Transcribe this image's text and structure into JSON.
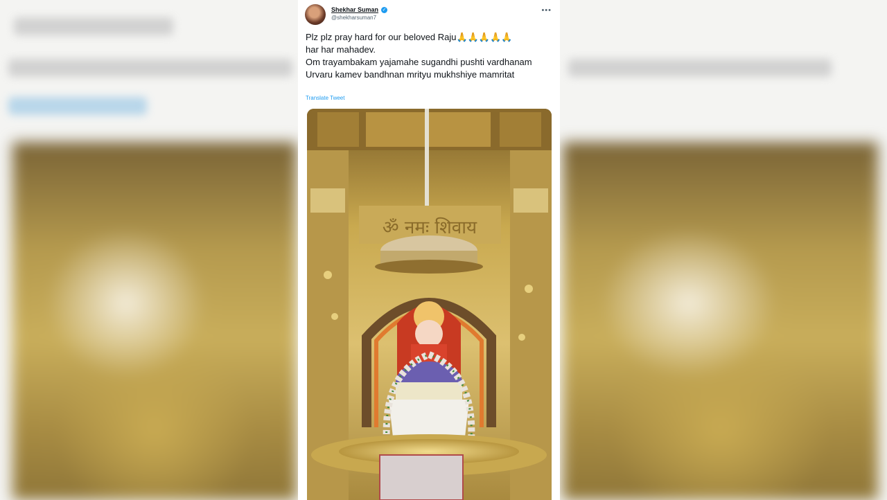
{
  "tweet": {
    "author_name": "Shekhar Suman",
    "author_handle": "@shekharsuman7",
    "more_icon": "more-horizontal-icon",
    "verified_icon": "verified-badge-icon",
    "lines": [
      "Plz plz pray hard for our beloved Raju🙏🙏🙏🙏🙏",
      "har har mahadev.",
      "Om trayambakam yajamahe sugandhi pushti vardhanam",
      "Urvaru kamev bandhnan mrityu mukhshiye mamritat"
    ],
    "translate_label": "Translate Tweet",
    "media_inscription": "ॐ नमः शिवाय"
  },
  "colors": {
    "text": "#0f1419",
    "secondary": "#536471",
    "link": "#1d9bf0",
    "gold": "#c9a94f"
  }
}
